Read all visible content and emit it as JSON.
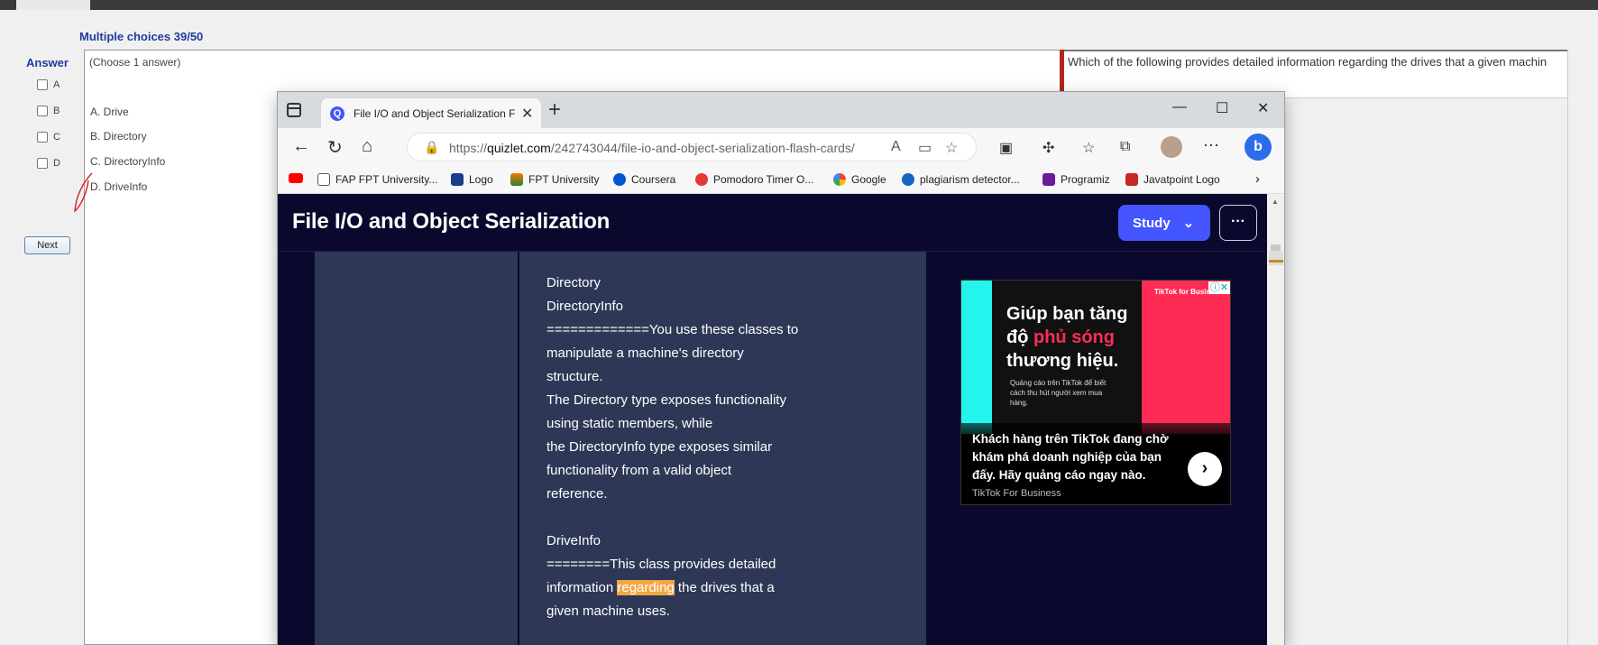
{
  "exam": {
    "title": "Multiple choices 39/50",
    "answer_label": "Answer",
    "answer_options": [
      "A",
      "B",
      "C",
      "D"
    ],
    "next_label": "Next",
    "choose_hint": "(Choose 1 answer)",
    "options": [
      "A.  Drive",
      "B.  Directory",
      "C.  DirectoryInfo",
      "D.  DriveInfo"
    ],
    "question": "Which of the following provides detailed information regarding the drives that a given machin"
  },
  "browser": {
    "tab_title": "File I/O and Object Serialization F",
    "url_prefix": "https://",
    "url_host": "quizlet.com",
    "url_path": "/242743044/file-io-and-object-serialization-flash-cards/",
    "bookmarks": [
      {
        "label": "FAP FPT University...",
        "icon": "page-icon"
      },
      {
        "label": "Logo",
        "icon": "logo-icon"
      },
      {
        "label": "FPT University",
        "icon": "fpt-icon"
      },
      {
        "label": "Coursera",
        "icon": "coursera-icon"
      },
      {
        "label": "Pomodoro Timer O...",
        "icon": "pomodoro-icon"
      },
      {
        "label": "Google",
        "icon": "google-icon"
      },
      {
        "label": "plagiarism detector...",
        "icon": "plagiarism-icon"
      },
      {
        "label": "Programiz",
        "icon": "programiz-icon"
      },
      {
        "label": "Javatpoint Logo",
        "icon": "javatpoint-icon"
      }
    ]
  },
  "quizlet": {
    "set_title": "File I/O and Object Serialization",
    "study_label": "Study",
    "definition_lines": [
      "Directory",
      "DirectoryInfo",
      "=============You use these classes to",
      "manipulate a machine's directory",
      "structure.",
      "The Directory type exposes functionality",
      "using static members, while",
      "the DirectoryInfo type exposes similar",
      "functionality from a valid object",
      "reference.",
      "",
      "DriveInfo",
      "========This class provides detailed"
    ],
    "highlight_line_before": "information ",
    "highlight_word": "regarding",
    "highlight_line_after": " the drives that a",
    "last_line": "given machine uses."
  },
  "ad": {
    "headline_1": "Giúp bạn tăng",
    "headline_2a": "độ ",
    "headline_2b": "phủ sóng",
    "headline_3": "thương hiệu.",
    "sub": "Quảng cáo trên TikTok để biết cách thu hút người xem mua hàng.",
    "tiktok_tag": "TikTok for Business",
    "caption": "Khách hàng trên TikTok đang chờ khám phá doanh nghiệp của bạn đấy. Hãy quảng cáo ngay nào.",
    "brand": "TikTok For Business"
  },
  "colors": {
    "quizlet_bg": "#0a092d",
    "quizlet_card": "#2e3856",
    "quizlet_accent": "#4255ff",
    "highlight": "#f3a642",
    "exam_blue": "#1f3b9c"
  }
}
